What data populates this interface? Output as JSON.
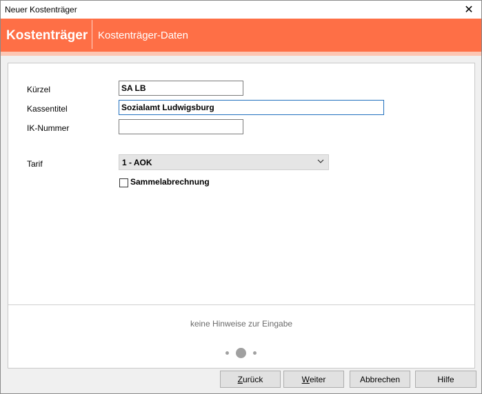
{
  "window": {
    "title": "Neuer Kostenträger"
  },
  "header": {
    "title": "Kostenträger",
    "subtitle": "Kostenträger-Daten"
  },
  "form": {
    "kuerzel": {
      "label": "Kürzel",
      "value": "SA LB"
    },
    "kassentitel": {
      "label": "Kassentitel",
      "value": "Sozialamt Ludwigsburg"
    },
    "ik_nummer": {
      "label": "IK-Nummer",
      "value": ""
    },
    "tarif": {
      "label": "Tarif",
      "value": "1 - AOK"
    },
    "sammelabrechnung": {
      "label": "Sammelabrechnung",
      "checked": false
    }
  },
  "hint": "keine Hinweise zur Eingabe",
  "pager": {
    "current": 2,
    "total": 3
  },
  "buttons": {
    "back": {
      "mnemonic": "Z",
      "rest": "urück"
    },
    "next": {
      "mnemonic": "W",
      "rest": "eiter"
    },
    "cancel": {
      "label": "Abbrechen"
    },
    "help": {
      "label": "Hilfe"
    }
  },
  "colors": {
    "accent": "#fe6f46",
    "accent_light": "#fdc6b3"
  }
}
